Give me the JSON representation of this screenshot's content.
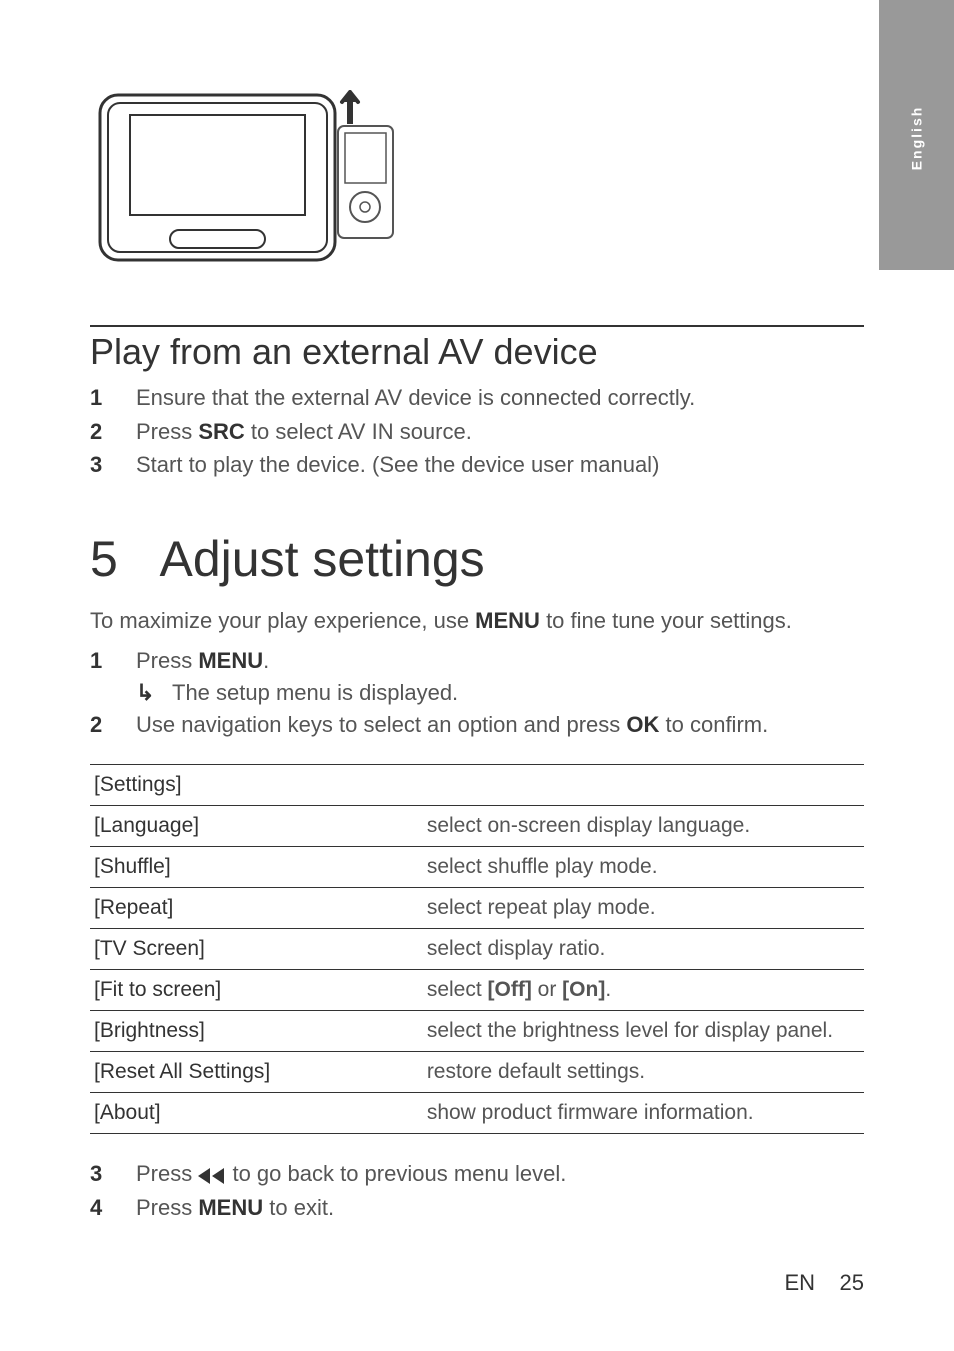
{
  "lang_tab": "English",
  "section1_title": "Play from an external AV device",
  "section1_items": [
    {
      "num": "1",
      "parts": [
        "Ensure that the external AV device is connected correctly."
      ]
    },
    {
      "num": "2",
      "parts": [
        "Press ",
        "SRC",
        " to select AV IN source."
      ]
    },
    {
      "num": "3",
      "parts": [
        "Start to play the device. (See the device user manual)"
      ]
    }
  ],
  "chapter_num": "5",
  "chapter_title": "Adjust settings",
  "intro_parts": [
    "To maximize your play experience, use ",
    "MENU",
    " to fine tune your settings."
  ],
  "use_items": {
    "i1_num": "1",
    "i1_parts": [
      "Press ",
      "MENU",
      "."
    ],
    "i1_sub": "The setup menu is displayed.",
    "i2_num": "2",
    "i2_parts": [
      "Use navigation keys to select an option and press ",
      "OK",
      " to confirm."
    ]
  },
  "table": [
    {
      "k": "[Settings]",
      "v": ""
    },
    {
      "k": "[Language]",
      "v": "select on-screen display language."
    },
    {
      "k": "[Shuffle]",
      "v": "select shuffle play mode."
    },
    {
      "k": "[Repeat]",
      "v": "select repeat play mode."
    },
    {
      "k": "[TV Screen]",
      "v": "select display ratio."
    },
    {
      "k": "[Fit to screen]",
      "v_parts": [
        "select ",
        "[Off]",
        " or ",
        "[On]",
        "."
      ]
    },
    {
      "k": "[Brightness]",
      "v": "select the brightness level for display panel."
    },
    {
      "k": "[Reset All Settings]",
      "v": "restore default settings."
    },
    {
      "k": "[About]",
      "v": "show product firmware information."
    }
  ],
  "post_items": {
    "i3_num": "3",
    "i3_parts_a": "Press ",
    "i3_parts_b": " to go back to previous menu level.",
    "i4_num": "4",
    "i4_parts": [
      "Press ",
      "MENU",
      " to exit."
    ]
  },
  "footer": {
    "lang": "EN",
    "page": "25"
  }
}
